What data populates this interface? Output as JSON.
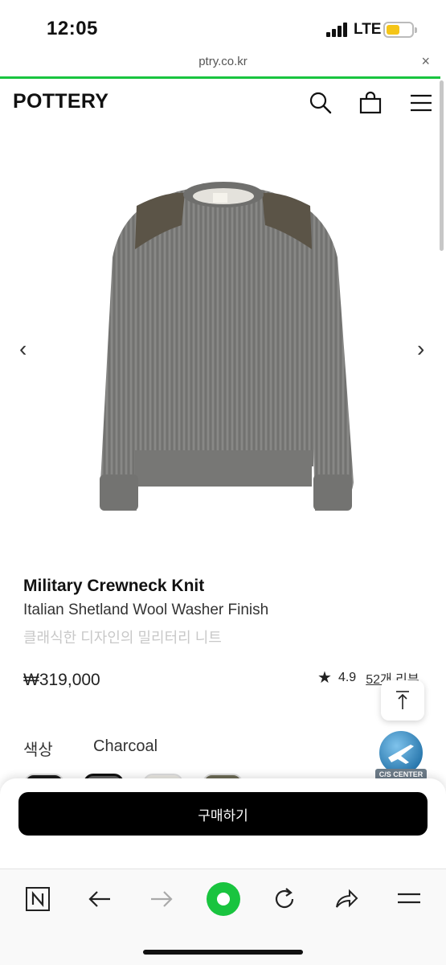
{
  "status_bar": {
    "time": "12:05",
    "network": "LTE"
  },
  "browser": {
    "url": "ptry.co.kr",
    "close_glyph": "×"
  },
  "header": {
    "logo": "POTTERY",
    "icons": [
      "search-icon",
      "shopping-bag-icon",
      "menu-icon"
    ]
  },
  "gallery": {
    "prev_glyph": "‹",
    "next_glyph": "›",
    "image": "sweater-image"
  },
  "product": {
    "name": "Military Crewneck Knit",
    "subtitle": "Italian Shetland Wool Washer Finish",
    "description": "클래식한 디자인의 밀리터리 니트",
    "price": "₩319,000",
    "rating": "4.9",
    "reviews": "52개 리뷰"
  },
  "options": {
    "color_label": "색상",
    "color_value": "Charcoal",
    "swatches": [
      "#1a1a1a",
      "#5e5e5e",
      "#e9e7e2",
      "#6b6a55"
    ]
  },
  "cs_center": {
    "label": "C/S CENTER"
  },
  "buy": {
    "label": "구매하기"
  },
  "toolbar": {
    "icons": [
      "naver-n-icon",
      "back-icon",
      "forward-icon",
      "green-dot-icon",
      "reload-icon",
      "share-icon",
      "menu-icon"
    ]
  },
  "colors": {
    "accent": "#19c43f",
    "battery": "#f5c518",
    "sweater": "#7a7a78",
    "suede": "#5b5447"
  }
}
